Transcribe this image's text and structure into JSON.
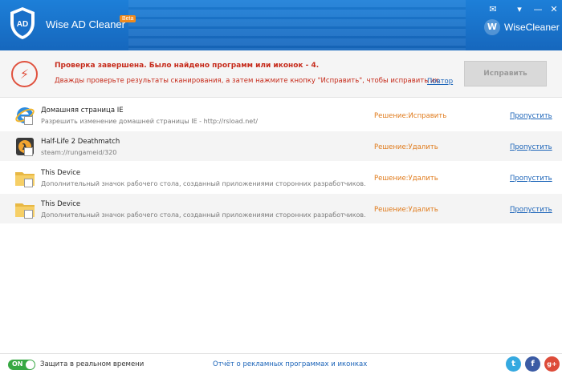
{
  "app": {
    "title": "Wise AD Cleaner",
    "beta": "Beta",
    "brand": "WiseCleaner",
    "brand_letter": "W"
  },
  "window_controls": [
    {
      "name": "feedback-icon",
      "glyph": "✉"
    },
    {
      "name": "menu-icon",
      "glyph": "▾"
    },
    {
      "name": "minimize-icon",
      "glyph": "—"
    },
    {
      "name": "close-icon",
      "glyph": "✕"
    }
  ],
  "status": {
    "title": "Проверка завершена. Было найдено программ или иконок - 4.",
    "subtitle": "Дважды проверьте результаты сканирования, а затем нажмите кнопку \"Исправить\", чтобы исправить их.",
    "rescan": "Повтор",
    "fix_button": "Исправить"
  },
  "items": [
    {
      "title": "Домашняя страница IE",
      "desc": "Разрешить изменение домашней страницы IE - http://rsload.net/",
      "decision": "Решение:Исправить",
      "skip": "Пропустить",
      "icon": "ie-icon"
    },
    {
      "title": "Half-Life 2 Deathmatch",
      "desc": "steam://rungameid/320",
      "decision": "Решение:Удалить",
      "skip": "Пропустить",
      "icon": "halflife-icon"
    },
    {
      "title": "This Device",
      "desc": "Дополнительный значок рабочего стола, созданный приложениями сторонних разработчиков.",
      "decision": "Решение:Удалить",
      "skip": "Пропустить",
      "icon": "folder-icon"
    },
    {
      "title": "This Device",
      "desc": "Дополнительный значок рабочего стола, созданный приложениями сторонних разработчиков.",
      "decision": "Решение:Удалить",
      "skip": "Пропустить",
      "icon": "folder-icon"
    }
  ],
  "footer": {
    "toggle": "ON",
    "realtime": "Защита в реальном времени",
    "report": "Отчёт о рекламных программах и иконках",
    "social": [
      {
        "name": "twitter-icon",
        "glyph": "t",
        "color": "#35a9e0"
      },
      {
        "name": "facebook-icon",
        "glyph": "f",
        "color": "#3b5ba4"
      },
      {
        "name": "googleplus-icon",
        "glyph": "g+",
        "color": "#dd4b39"
      }
    ]
  },
  "colors": {
    "header": "#1d7fd8",
    "error": "#c62b1b",
    "decision": "#e07a1a",
    "link": "#1a63b8",
    "toggle": "#37a843"
  }
}
